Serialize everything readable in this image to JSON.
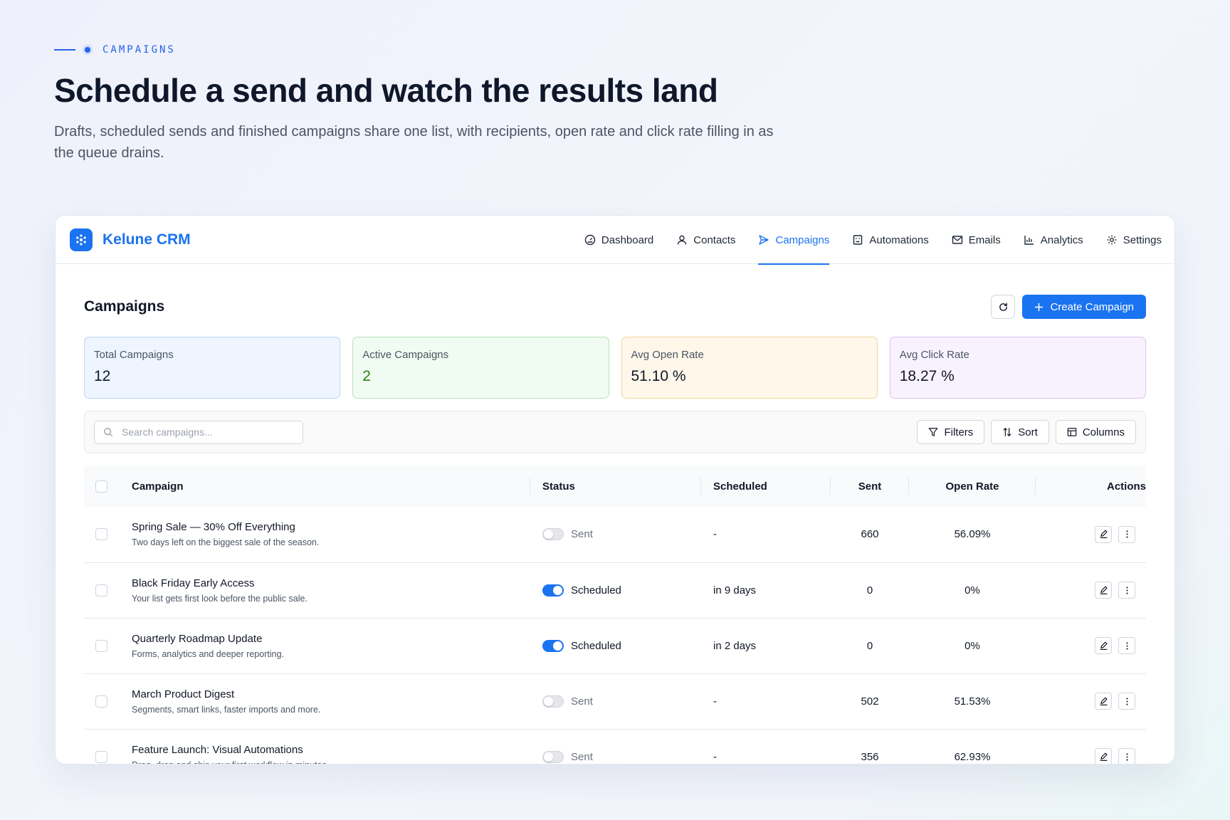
{
  "hero": {
    "eyebrow": "CAMPAIGNS",
    "title": "Schedule a send and watch the results land",
    "subtitle": "Drafts, scheduled sends and finished campaigns share one list, with recipients, open rate and click rate filling in as the queue drains."
  },
  "app": {
    "brand": "Kelune CRM",
    "accent": "#1a73f0",
    "nav": [
      {
        "label": "Dashboard",
        "icon": "gauge-icon"
      },
      {
        "label": "Contacts",
        "icon": "user-icon"
      },
      {
        "label": "Campaigns",
        "icon": "send-icon",
        "active": true
      },
      {
        "label": "Automations",
        "icon": "robot-icon"
      },
      {
        "label": "Emails",
        "icon": "mail-icon"
      },
      {
        "label": "Analytics",
        "icon": "bar-chart-icon"
      },
      {
        "label": "Settings",
        "icon": "gear-icon"
      }
    ]
  },
  "page": {
    "title": "Campaigns",
    "create_label": "Create Campaign"
  },
  "stats": [
    {
      "label": "Total Campaigns",
      "value": "12"
    },
    {
      "label": "Active Campaigns",
      "value": "2"
    },
    {
      "label": "Avg Open Rate",
      "value": "51.10 %"
    },
    {
      "label": "Avg Click Rate",
      "value": "18.27 %"
    }
  ],
  "toolbar": {
    "search_placeholder": "Search campaigns...",
    "filters": "Filters",
    "sort": "Sort",
    "columns": "Columns"
  },
  "table": {
    "headers": {
      "campaign": "Campaign",
      "status": "Status",
      "scheduled": "Scheduled",
      "sent": "Sent",
      "open_rate": "Open Rate",
      "actions": "Actions"
    },
    "rows": [
      {
        "name": "Spring Sale — 30% Off Everything",
        "desc": "Two days left on the biggest sale of the season.",
        "status": "Sent",
        "scheduled": "-",
        "sent": "660",
        "open_rate": "56.09%"
      },
      {
        "name": "Black Friday Early Access",
        "desc": "Your list gets first look before the public sale.",
        "status": "Scheduled",
        "scheduled": "in 9 days",
        "sent": "0",
        "open_rate": "0%"
      },
      {
        "name": "Quarterly Roadmap Update",
        "desc": "Forms, analytics and deeper reporting.",
        "status": "Scheduled",
        "scheduled": "in 2 days",
        "sent": "0",
        "open_rate": "0%"
      },
      {
        "name": "March Product Digest",
        "desc": "Segments, smart links, faster imports and more.",
        "status": "Sent",
        "scheduled": "-",
        "sent": "502",
        "open_rate": "51.53%"
      },
      {
        "name": "Feature Launch: Visual Automations",
        "desc": "Drag, drop and ship your first workflow in minutes.",
        "status": "Sent",
        "scheduled": "-",
        "sent": "356",
        "open_rate": "62.93%"
      }
    ]
  }
}
